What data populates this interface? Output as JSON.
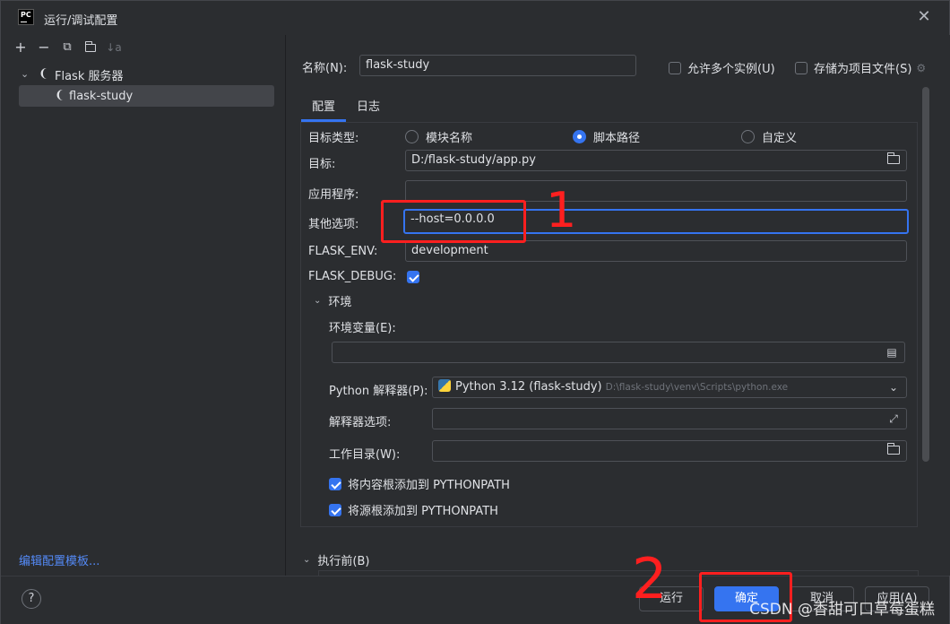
{
  "window": {
    "title": "运行/调试配置"
  },
  "toolbar": {
    "add": "+",
    "remove": "−",
    "copy": "⧉",
    "new_folder": "📁",
    "sort": "↓a"
  },
  "tree": {
    "group_label": "Flask 服务器",
    "child_label": "flask-study"
  },
  "left_footer": {
    "template_link": "编辑配置模板..."
  },
  "header": {
    "name_label": "名称(N):",
    "name_value": "flask-study",
    "allow_multiple_label": "允许多个实例(U)",
    "store_as_file_label": "存储为项目文件(S)"
  },
  "tabs": [
    "配置",
    "日志"
  ],
  "config": {
    "target_type_label": "目标类型:",
    "target_type_options": [
      "模块名称",
      "脚本路径",
      "自定义"
    ],
    "target_type_selected": "脚本路径",
    "target_label": "目标:",
    "target_value": "D:/flask-study/app.py",
    "app_label": "应用程序:",
    "app_value": "",
    "other_options_label": "其他选项:",
    "other_options_value": "--host=0.0.0.0",
    "flask_env_label": "FLASK_ENV:",
    "flask_env_value": "development",
    "flask_debug_label": "FLASK_DEBUG:",
    "flask_debug_checked": true,
    "env_section_label": "环境",
    "env_vars_label": "环境变量(E):",
    "env_vars_value": "",
    "interpreter_label": "Python 解释器(P):",
    "interpreter_value": "Python 3.12 (flask-study)",
    "interpreter_path": "D:\\flask-study\\venv\\Scripts\\python.exe",
    "interpreter_opts_label": "解释器选项:",
    "interpreter_opts_value": "",
    "workdir_label": "工作目录(W):",
    "workdir_value": "",
    "add_content_roots_label": "将内容根添加到 PYTHONPATH",
    "add_source_roots_label": "将源根添加到 PYTHONPATH",
    "before_launch_label": "执行前(B)"
  },
  "footer": {
    "help": "?",
    "run": "运行",
    "ok": "确定",
    "cancel": "取消",
    "apply": "应用(A)"
  },
  "annotations": {
    "mark1": "1",
    "mark2": "2"
  },
  "watermark": "CSDN @香甜可口草莓蛋糕",
  "colors": {
    "accent": "#3574f0",
    "annotation": "#ff1f1f",
    "link": "#548af7"
  }
}
